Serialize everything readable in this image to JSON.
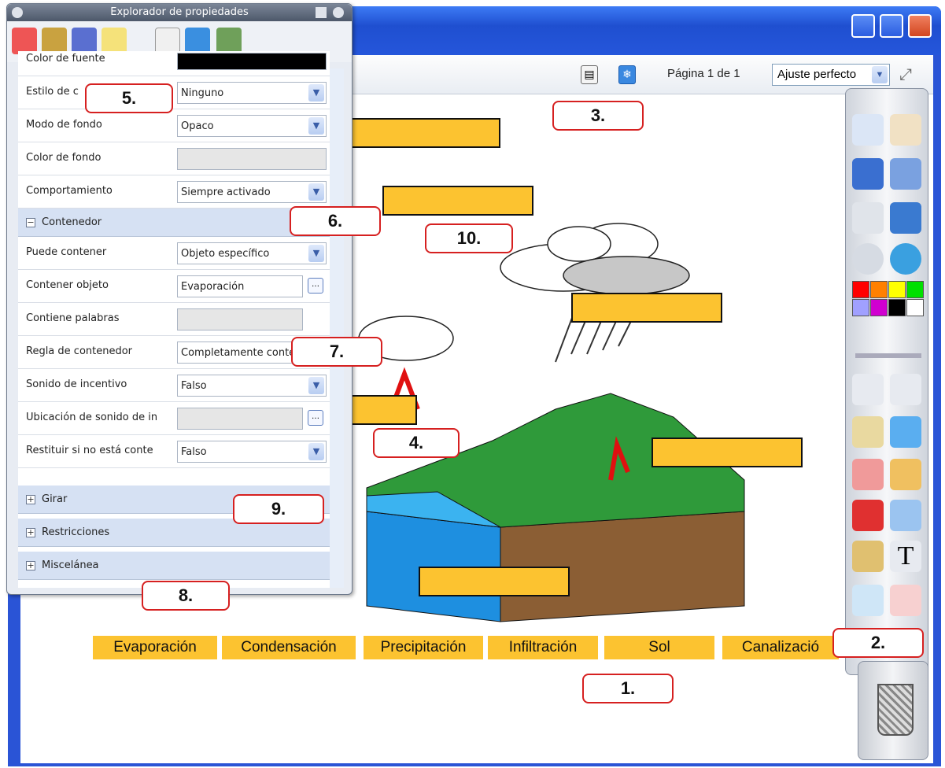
{
  "app": {
    "window_buttons": [
      "minimize",
      "maximize",
      "close"
    ]
  },
  "toolbar": {
    "page_label": "Página 1 de 1",
    "zoom_value": "Ajuste perfecto"
  },
  "properties_explorer": {
    "title": "Explorador de propiedades",
    "rows": [
      {
        "label": "Color de fuente",
        "value": ""
      },
      {
        "label": "Estilo de c",
        "value": "Ninguno"
      },
      {
        "label": "Modo de fondo",
        "value": "Opaco"
      },
      {
        "label": "Color de fondo",
        "value": ""
      },
      {
        "label": "Comportamiento",
        "value": "Siempre activado"
      }
    ],
    "section_contenedor": "Contenedor",
    "contenedor_rows": [
      {
        "label": "Puede contener",
        "value": "Objeto específico"
      },
      {
        "label": "Contener objeto",
        "value": "Evaporación"
      },
      {
        "label": "Contiene palabras",
        "value": ""
      },
      {
        "label": "Regla de contenedor",
        "value": "Completamente conter"
      },
      {
        "label": "Sonido de incentivo",
        "value": "Falso"
      },
      {
        "label": "Ubicación de sonido de in",
        "value": ""
      },
      {
        "label": "Restituir si no está conte",
        "value": "Falso"
      }
    ],
    "collapsed_sections": [
      "Girar",
      "Restricciones",
      "Miscelánea"
    ]
  },
  "word_tiles": [
    "Evaporación",
    "Condensación",
    "Precipitación",
    "Infiltración",
    "Sol",
    "Canalizació"
  ],
  "callouts": [
    "1.",
    "2.",
    "3.",
    "4.",
    "5.",
    "6.",
    "7.",
    "8.",
    "9.",
    "10."
  ],
  "colors": {
    "accent_yellow": "#fcc330",
    "callout_border": "#d62020",
    "xp_blue": "#2a54d6"
  },
  "palette_colors": [
    "#ff0000",
    "#ff8000",
    "#ffff00",
    "#00e000",
    "#a0a0ff",
    "#d000d0",
    "#000000",
    "#ffffff"
  ]
}
